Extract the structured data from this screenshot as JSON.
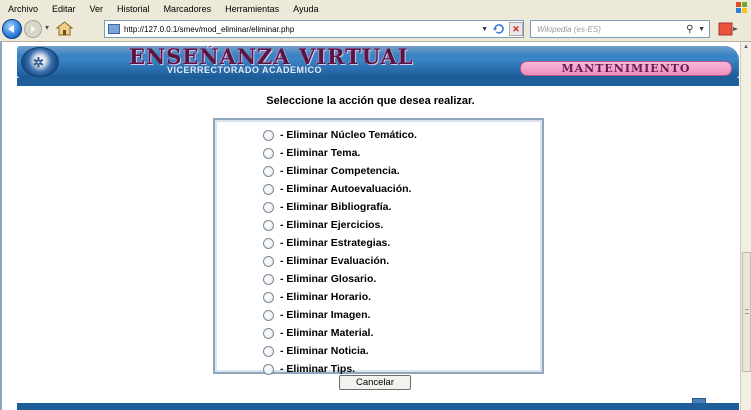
{
  "browser": {
    "menu": [
      "Archivo",
      "Editar",
      "Ver",
      "Historial",
      "Marcadores",
      "Herramientas",
      "Ayuda"
    ],
    "address": "http://127.0.0.1/smev/mod_eliminar/eliminar.php",
    "search_placeholder": "Wikipedia (es-ES)"
  },
  "banner": {
    "title": "ENSEÑANZA VIRTUAL",
    "subtitle": "VICERRECTORADO ACADEMICO",
    "badge": "MANTENIMIENTO"
  },
  "main": {
    "heading": "Seleccione la acción que desea realizar.",
    "options": [
      {
        "label": "- Eliminar Núcleo Temático."
      },
      {
        "label": "- Eliminar Tema."
      },
      {
        "label": "- Eliminar Competencia."
      },
      {
        "label": "- Eliminar Autoevaluación."
      },
      {
        "label": "- Eliminar Bibliografía."
      },
      {
        "label": "- Eliminar Ejercicios."
      },
      {
        "label": "- Eliminar Estrategias."
      },
      {
        "label": "- Eliminar Evaluación."
      },
      {
        "label": "- Eliminar Glosario."
      },
      {
        "label": "- Eliminar Horario."
      },
      {
        "label": "- Eliminar Imagen."
      },
      {
        "label": "- Eliminar Material."
      },
      {
        "label": "- Eliminar Noticia."
      },
      {
        "label": "- Eliminar Tips."
      }
    ],
    "cancel_label": "Cancelar"
  },
  "colors": {
    "banner_blue": "#1f5f99",
    "badge_pink": "#ec8fbf",
    "title_purple": "#5a1640"
  }
}
